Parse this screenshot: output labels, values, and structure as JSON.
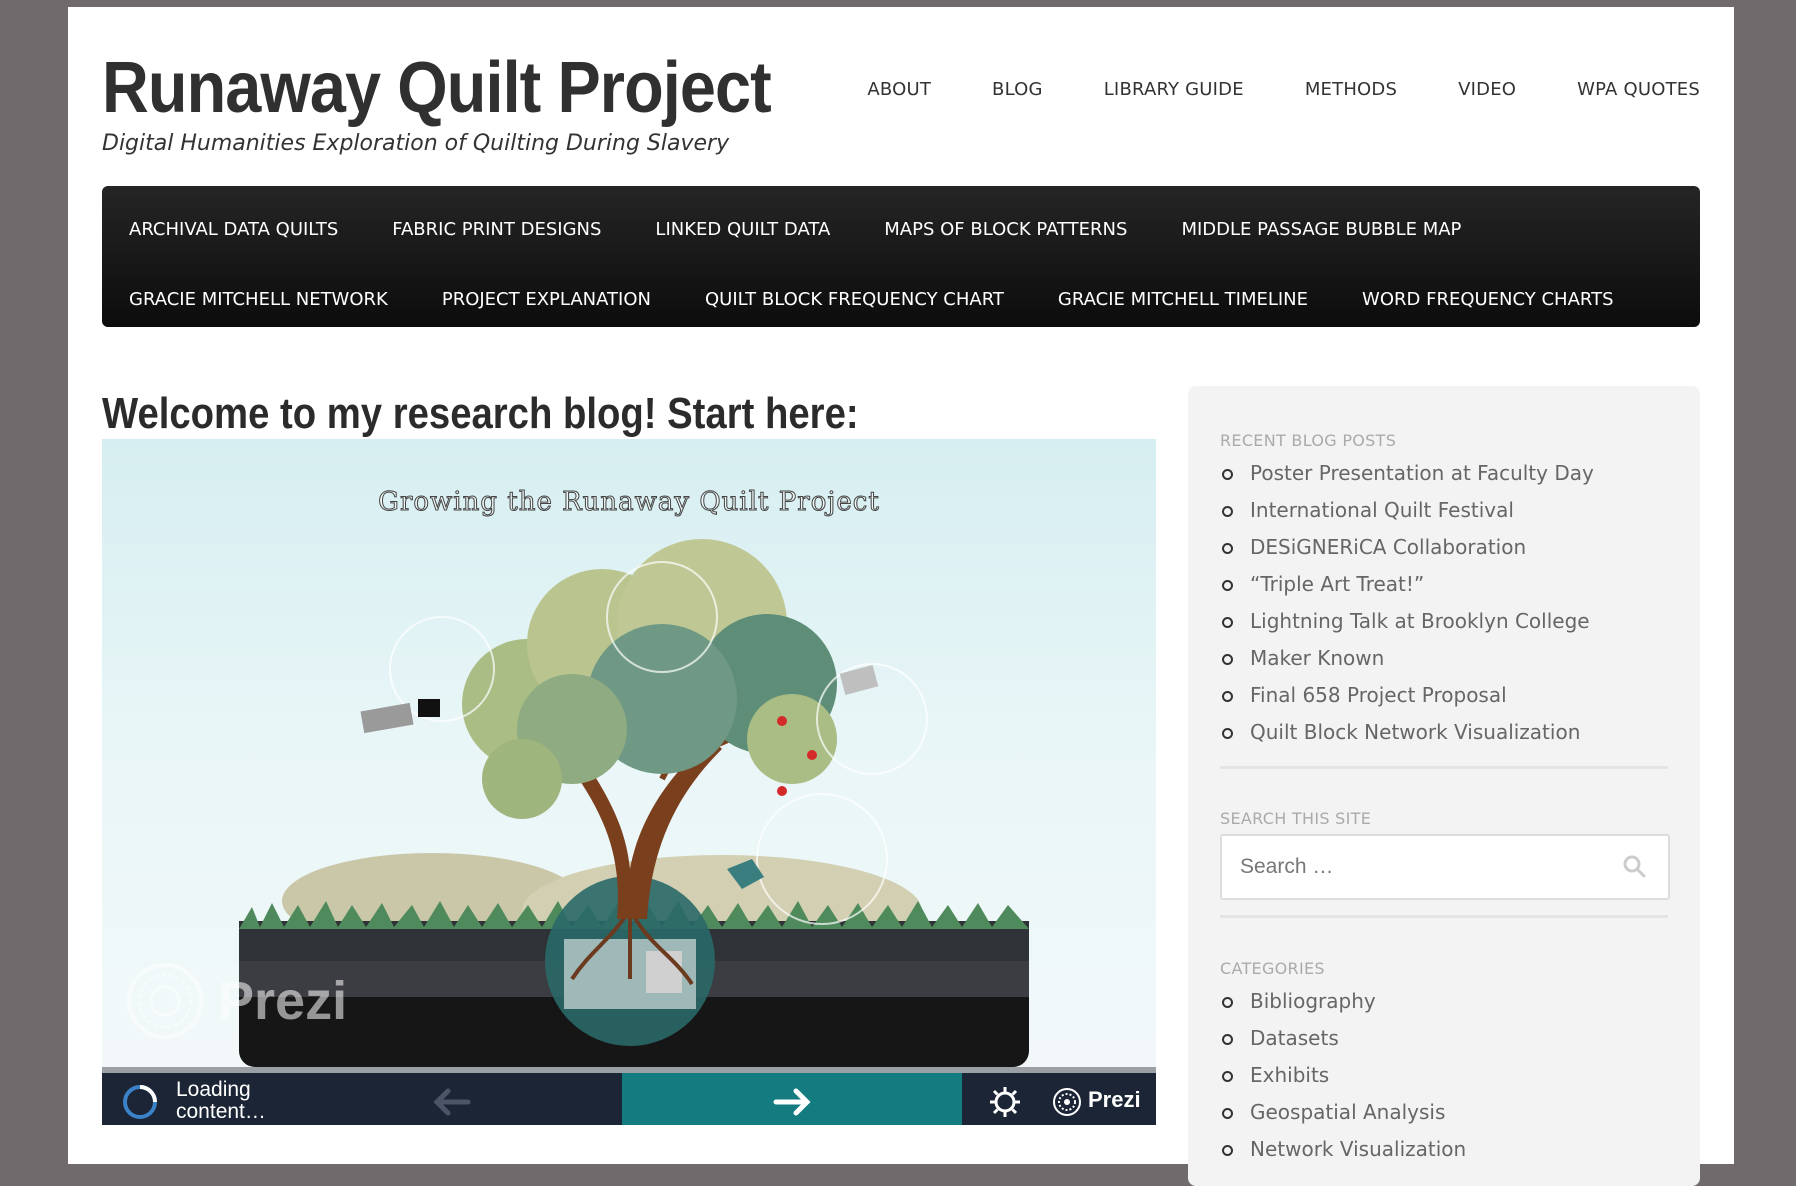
{
  "site": {
    "title": "Runaway Quilt Project",
    "description": "Digital Humanities Exploration of Quilting During Slavery"
  },
  "top_nav": [
    "ABOUT",
    "BLOG",
    "LIBRARY GUIDE",
    "METHODS",
    "VIDEO",
    "WPA QUOTES"
  ],
  "main_nav": {
    "row1": [
      "ARCHIVAL DATA QUILTS",
      "FABRIC PRINT DESIGNS",
      "LINKED QUILT DATA",
      "MAPS OF BLOCK PATTERNS",
      "MIDDLE PASSAGE BUBBLE MAP"
    ],
    "row2": [
      "GRACIE MITCHELL NETWORK",
      "PROJECT EXPLANATION",
      "QUILT BLOCK FREQUENCY CHART",
      "GRACIE MITCHELL TIMELINE",
      "WORD FREQUENCY CHARTS"
    ]
  },
  "post": {
    "title": "Welcome to my research blog! Start here:",
    "embed": {
      "presentation_title": "Growing the Runaway Quilt Project",
      "watermark": "Prezi",
      "loading_line1": "Loading",
      "loading_line2": "content…",
      "brand": "Prezi"
    }
  },
  "sidebar": {
    "recent_title": "RECENT BLOG POSTS",
    "recent_posts": [
      "Poster Presentation at Faculty Day",
      "International Quilt Festival",
      "DESiGNERiCA Collaboration",
      "“Triple Art Treat!”",
      "Lightning Talk at Brooklyn College",
      "Maker Known",
      "Final 658 Project Proposal",
      "Quilt Block Network Visualization"
    ],
    "search_title": "SEARCH THIS SITE",
    "search_placeholder": "Search …",
    "categories_title": "CATEGORIES",
    "categories": [
      "Bibliography",
      "Datasets",
      "Exhibits",
      "Geospatial Analysis",
      "Network Visualization"
    ]
  }
}
